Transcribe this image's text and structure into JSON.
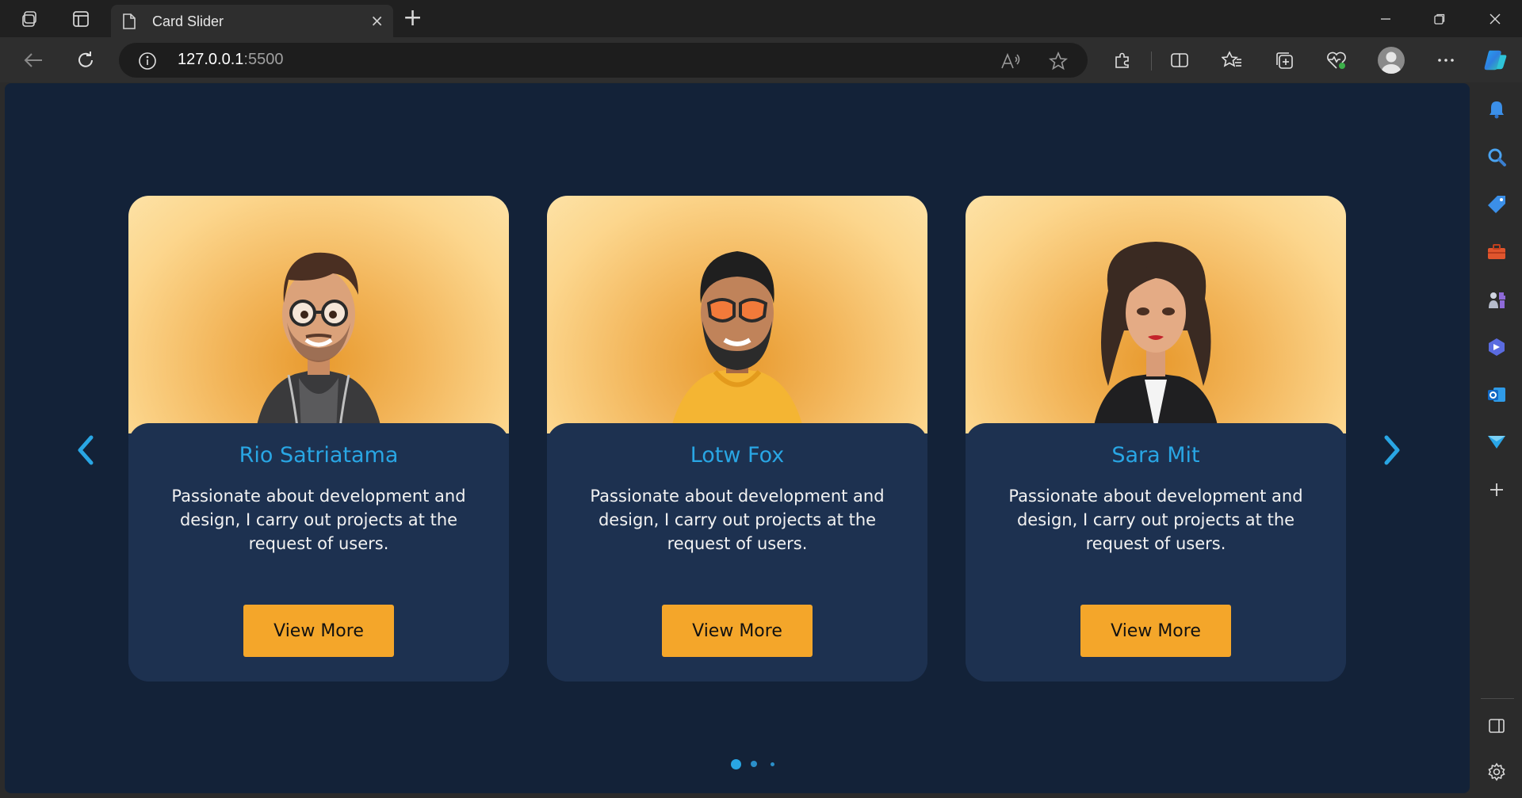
{
  "browser": {
    "tab_title": "Card Slider",
    "tab_close": "×",
    "new_tab": "+",
    "url_host": "127.0.0.1",
    "url_port": ":5500",
    "icons": {
      "workspaces": "workspaces-icon",
      "tab_actions": "tab-actions-icon",
      "page": "page-icon",
      "back": "back-arrow-icon",
      "refresh": "refresh-icon",
      "info": "info-icon",
      "read_aloud": "read-aloud-icon",
      "favorite": "star-icon",
      "extensions": "puzzle-icon",
      "split_screen": "split-screen-icon",
      "favorites": "favorites-icon",
      "collections": "collections-icon",
      "browser_essentials": "heart-pulse-icon",
      "profile": "profile-avatar-icon",
      "more": "more-icon",
      "copilot": "copilot-icon"
    },
    "window_controls": [
      "minimize",
      "restore",
      "close"
    ]
  },
  "sidebar": {
    "items": [
      "bell-icon",
      "search-icon",
      "shopping-tag-icon",
      "toolbox-icon",
      "games-icon",
      "bing-icon",
      "outlook-icon",
      "send-icon",
      "add-icon"
    ],
    "bottom": [
      "sidebar-toggle-icon",
      "settings-icon"
    ]
  },
  "slider": {
    "prev_label": "‹",
    "next_label": "›",
    "active_dot": 0,
    "dot_count": 3,
    "accent": "#29a6e4",
    "button_color": "#f4a62a",
    "cards": [
      {
        "name": "Rio Satriatama",
        "description": "Passionate about development and design, I carry out projects at the request of users.",
        "button": "View More"
      },
      {
        "name": "Lotw Fox",
        "description": "Passionate about development and design, I carry out projects at the request of users.",
        "button": "View More"
      },
      {
        "name": "Sara Mit",
        "description": "Passionate about development and design, I carry out projects at the request of users.",
        "button": "View More"
      }
    ]
  }
}
